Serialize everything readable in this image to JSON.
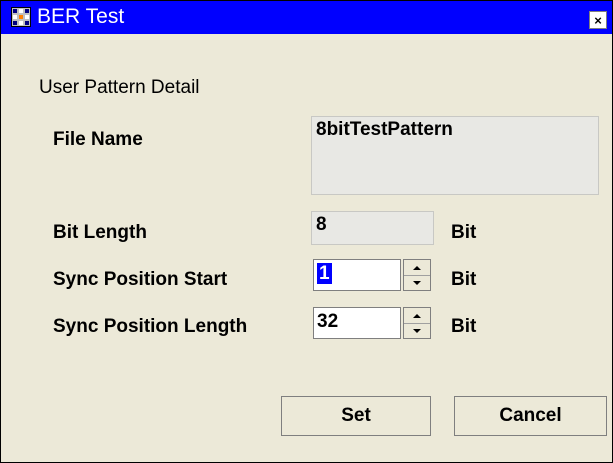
{
  "window": {
    "title": "BER Test",
    "close_glyph": "×"
  },
  "group": {
    "label": "User Pattern Detail"
  },
  "fields": {
    "file_name": {
      "label": "File Name",
      "value": "8bitTestPattern"
    },
    "bit_length": {
      "label": "Bit Length",
      "value": "8",
      "unit": "Bit"
    },
    "sync_position_start": {
      "label": "Sync Position Start",
      "value": "1",
      "unit": "Bit"
    },
    "sync_position_length": {
      "label": "Sync Position Length",
      "value": "32",
      "unit": "Bit"
    }
  },
  "buttons": {
    "set": "Set",
    "cancel": "Cancel"
  },
  "icons": {
    "app": "ber-app-icon",
    "close": "close-icon",
    "spin": "spin-up-down-icon"
  },
  "colors": {
    "titlebar": "#0000ff",
    "dialog_bg": "#ece9d8",
    "selection": "#0000ff"
  }
}
